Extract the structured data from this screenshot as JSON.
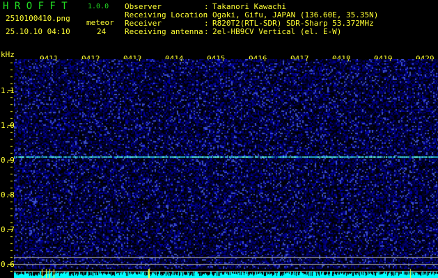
{
  "app": {
    "title": "H R O F F T",
    "version": "1.0.0"
  },
  "file": {
    "name": "2510100410.png",
    "datetime": "25.10.10 04:10"
  },
  "meteor": {
    "label": "meteor",
    "count": "24"
  },
  "info": [
    {
      "label": "Observer",
      "value": "Takanori Kawachi"
    },
    {
      "label": "Receiving Location",
      "value": "Ogaki, Gifu, JAPAN (136.60E, 35.35N)"
    },
    {
      "label": "Receiver",
      "value": "R820T2(RTL-SDR) SDR-Sharp 53.372MHz"
    },
    {
      "label": "Receiving antenna",
      "value": "2el-HB9CV Vertical (el. E-W)"
    }
  ],
  "y_axis": {
    "unit": "kHz",
    "ticks": [
      "1.1",
      "1.0",
      "0.9",
      "0.8",
      "0.7",
      "0.6"
    ]
  },
  "x_axis": {
    "ticks": [
      "0411",
      "0412",
      "0413",
      "0414",
      "0415",
      "0416",
      "0417",
      "0418",
      "0419",
      "0420"
    ]
  },
  "colors": {
    "text": "#ffff33",
    "title": "#22dd22",
    "background": "#000000",
    "noise": "#1a1aa0",
    "signal": "#33ffdd",
    "histogram": "#00ffff"
  }
}
